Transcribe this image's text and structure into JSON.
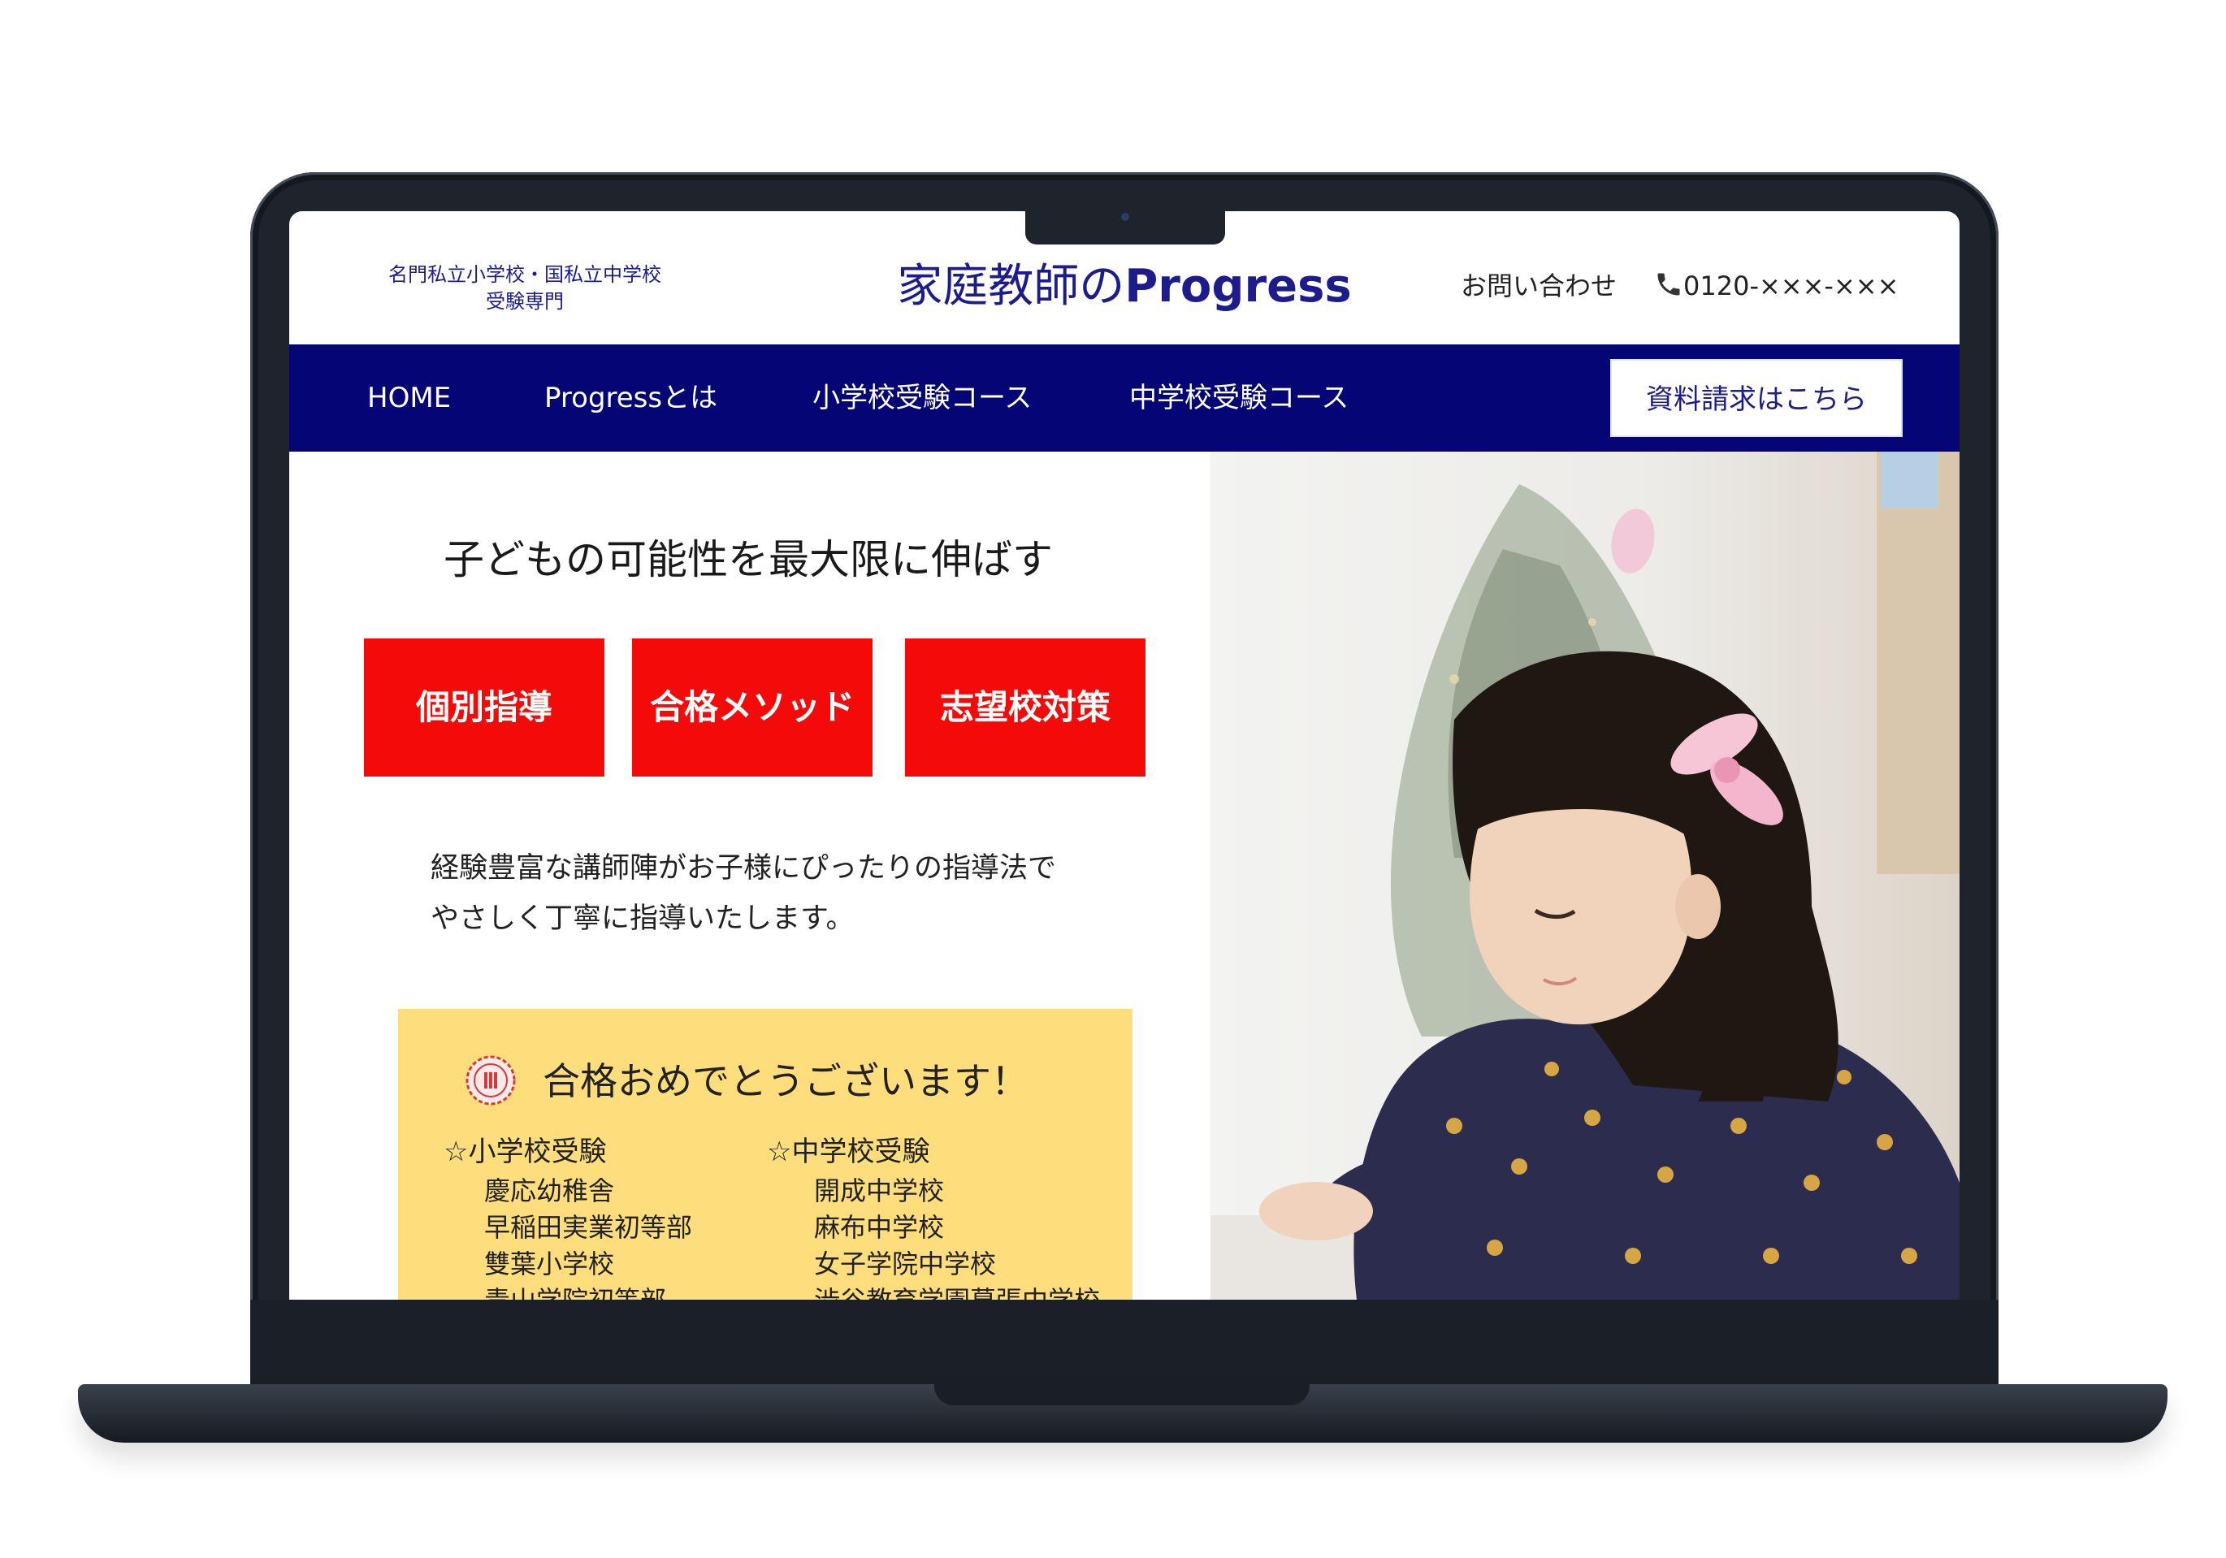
{
  "header": {
    "tagline_line1": "名門私立小学校・国私立中学校",
    "tagline_line2": "受験専門",
    "brand_jp": "家庭教師の",
    "brand_en": "Progress",
    "contact_label": "お問い合わせ",
    "phone": "0120-×××-×××"
  },
  "nav": {
    "items": [
      {
        "label": "HOME"
      },
      {
        "label": "Progressとは"
      },
      {
        "label": "小学校受験コース"
      },
      {
        "label": "中学校受験コース"
      }
    ],
    "cta_label": "資料請求はこちら"
  },
  "hero": {
    "headline": "子どもの可能性を最大限に伸ばす",
    "features": [
      "個別指導",
      "合格メソッド",
      "志望校対策"
    ],
    "description_line1": "経験豊富な講師陣がお子様にぴったりの指導法で",
    "description_line2": "やさしく丁寧に指導いたします。"
  },
  "congrats": {
    "title": "合格おめでとうございます！",
    "elementary": {
      "heading": "☆小学校受験",
      "schools": [
        "慶応幼稚舎",
        "早稲田実業初等部",
        "雙葉小学校",
        "青山学院初等部"
      ]
    },
    "junior_high": {
      "heading": "☆中学校受験",
      "schools": [
        "開成中学校",
        "麻布中学校",
        "女子学院中学校",
        "渋谷教育学園幕張中学校"
      ]
    }
  },
  "colors": {
    "brand_navy": "#050576",
    "feature_red": "#f50a0a",
    "congrats_yellow": "#fedd7c"
  },
  "icons": {
    "phone": "phone-icon",
    "seal": "seal-icon"
  }
}
